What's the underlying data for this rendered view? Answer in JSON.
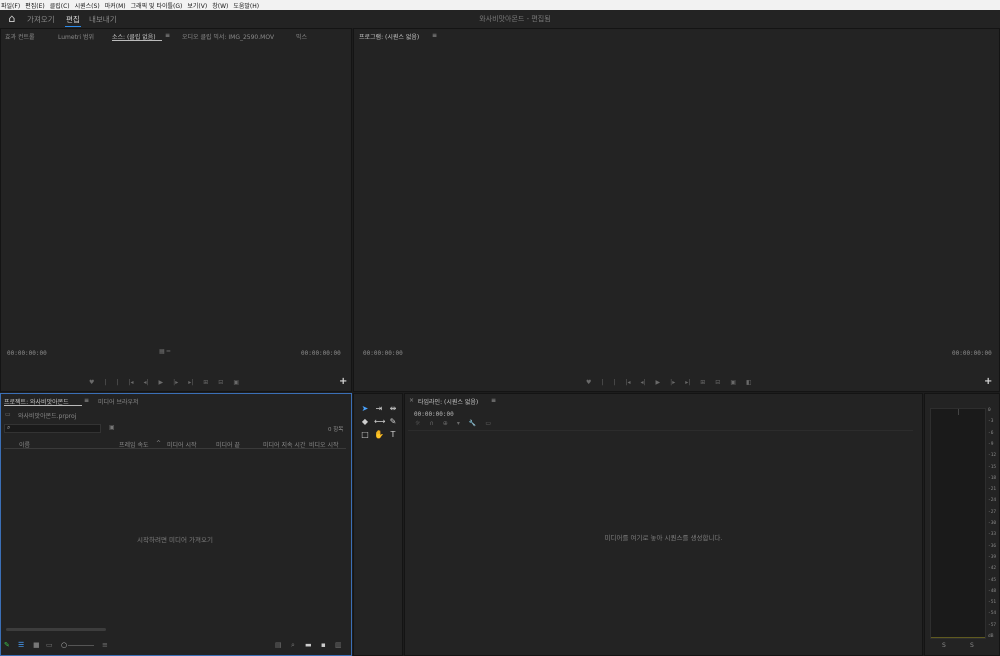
{
  "menubar": [
    "파일(F)",
    "편집(E)",
    "클립(C)",
    "시퀀스(S)",
    "마커(M)",
    "그래픽 및 타이틀(G)",
    "보기(V)",
    "창(W)",
    "도움말(H)"
  ],
  "workspaces": {
    "home_icon": "home-icon",
    "items": [
      "가져오기",
      "편집",
      "내보내기"
    ],
    "active": "편집"
  },
  "app_title": "와사비맛아몬드 - 편집됨",
  "source_panel": {
    "tabs": [
      "효과 컨트롤",
      "Lumetri 범위",
      "소스: (클립 없음)",
      "오디오 클립 믹서: IMG_2590.MOV",
      "믹스"
    ],
    "menu_icon": "≡",
    "timecode_left": "00:00:00:00",
    "timecode_right": "00:00:00:00"
  },
  "program_panel": {
    "tab": "프로그램: (시퀀스 없음)",
    "menu_icon": "≡",
    "timecode_left": "00:00:00:00",
    "timecode_right": "00:00:00:00"
  },
  "project_panel": {
    "tabs": [
      "프로젝트: 와사비맛아몬드",
      "미디어 브라우저"
    ],
    "menu_icon": "≡",
    "file_name": "와사비맛아몬드.prproj",
    "item_count": "0 항목",
    "columns": [
      "이름",
      "프레임 속도",
      "미디어 시작",
      "미디어 끝",
      "미디어 지속 시간",
      "비디오 시작"
    ],
    "empty_message": "시작하려면 미디어 가져오기"
  },
  "timeline_panel": {
    "tab": "타임라인: (시퀀스 없음)",
    "menu_icon": "≡",
    "timecode": "00:00:00:00",
    "empty_message": "미디어를 여기로 놓아 시퀀스를 생성합니다."
  },
  "audio_meter": {
    "scale": [
      "0",
      "-3",
      "-6",
      "-9",
      "-12",
      "-15",
      "-18",
      "-21",
      "-24",
      "-27",
      "-30",
      "-33",
      "-36",
      "-39",
      "-42",
      "-45",
      "-48",
      "-51",
      "-54",
      "-57",
      "dB"
    ],
    "solo_labels": [
      "S",
      "S"
    ]
  },
  "colors": {
    "accent_blue": "#2d8ceb",
    "panel_bg": "#232323",
    "focus_border": "#3b6fb6"
  }
}
